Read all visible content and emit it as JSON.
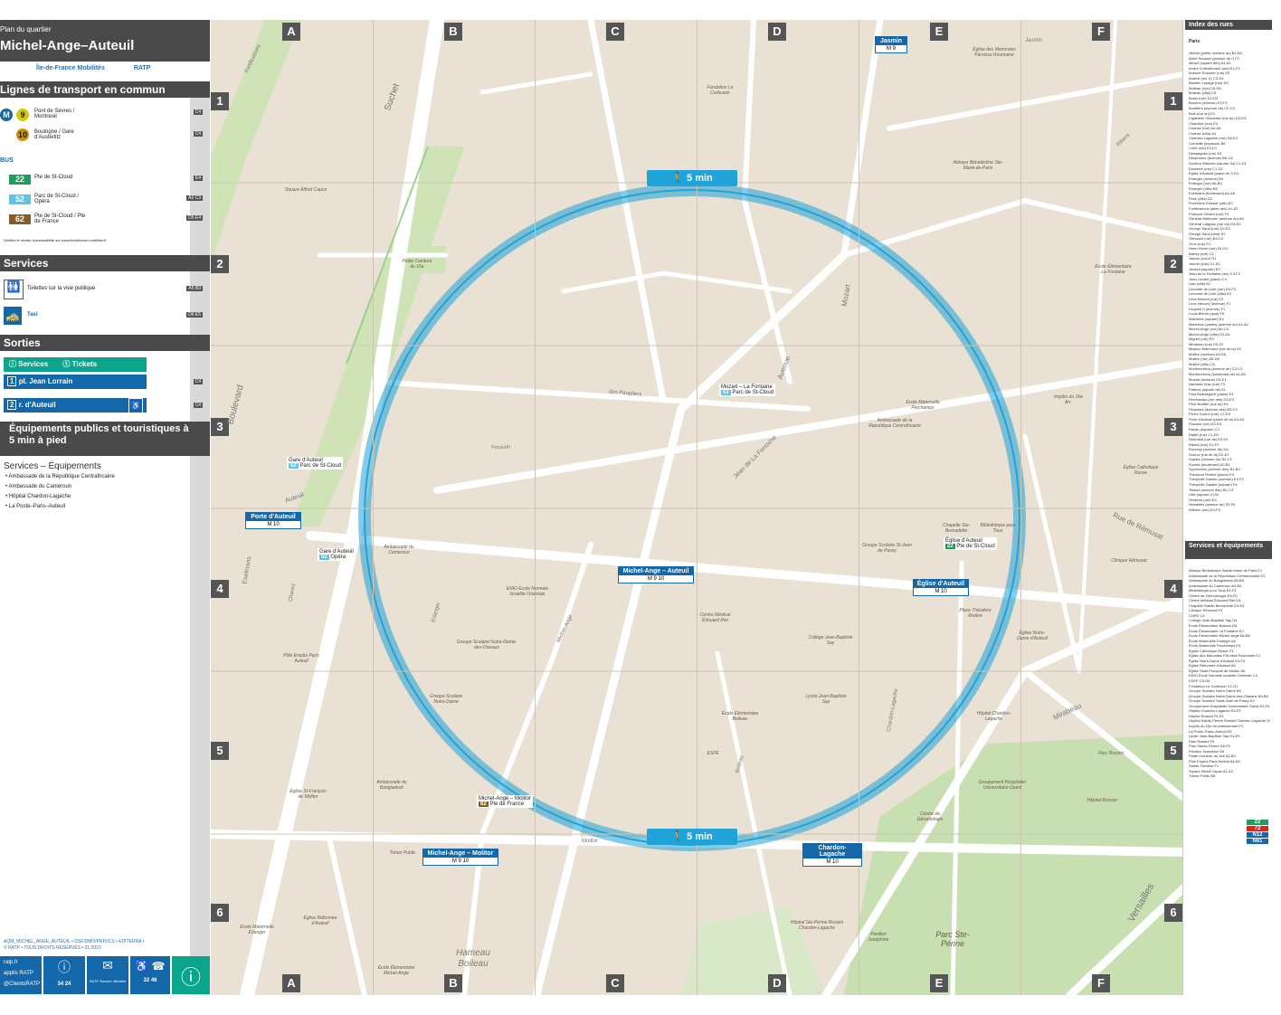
{
  "header": {
    "kicker": "Plan du quartier",
    "title": "Michel-Ange–Auteuil",
    "logo_idf": "Île-de-France Mobilités",
    "logo_ratp": "RATP"
  },
  "transport": {
    "heading": "Lignes de transport en commun",
    "metro": [
      {
        "line": "9",
        "color": "#d5c900",
        "dest": "Pont de Sèvres / Montreuil",
        "ref": "C4"
      },
      {
        "line": "10",
        "color": "#c9910d",
        "dest": "Boulogne / Gare d'Austerlitz",
        "ref": "C4"
      }
    ],
    "bus_label": "BUS",
    "bus": [
      {
        "line": "22",
        "color": "#1e9e5c",
        "dest": "Pte de St-Cloud",
        "ref": "E4"
      },
      {
        "line": "52",
        "color": "#5ec3e8",
        "dest": "Parc de St-Cloud / Opéra",
        "ref": "A3 C3"
      },
      {
        "line": "62",
        "color": "#8b5a2b",
        "dest": "Pte de St-Cloud / Pte de France",
        "ref": "D5 E4"
      }
    ],
    "note": "Vérifiez le niveau d'accessibilité sur www.iledefrance-mobilites.fr"
  },
  "services": {
    "heading": "Services",
    "items": [
      {
        "label": "Toilettes sur la voie publique",
        "ref": "A5 B3"
      },
      {
        "label": "Taxi",
        "ref": "D6 E5"
      }
    ]
  },
  "sorties": {
    "heading": "Sorties",
    "tab_services": "Services",
    "tab_tickets": "Tickets",
    "exits": [
      {
        "num": "1",
        "label": "pl. Jean Lorrain",
        "ref": "C4"
      },
      {
        "num": "2",
        "label": "r. d'Auteuil",
        "ref": "C4"
      }
    ]
  },
  "equipements": {
    "heading": "Équipements publics et touristiques à 5 min à pied",
    "sub": "Services – Équipements",
    "items": [
      "Ambassade de la République Centrafricaine",
      "Ambassade du Cameroun",
      "Hôpital Chardon-Lagache",
      "La Poste–Paris–Auteuil"
    ]
  },
  "footer": {
    "code": "AQM_MICHEL_ANGE_AUTEUIL • DSF/DMO/PRIVICS • EDITERRA •",
    "rights": "© RATP • TOUS DROITS RÉSERVÉS • 01.2023",
    "links": [
      "ratp.fr",
      "applis RATP",
      "@ClientsRATP"
    ],
    "phone1": "34 24",
    "mail": "RATP Service clientèle",
    "phone2": "32 46"
  },
  "map": {
    "columns": [
      "A",
      "B",
      "C",
      "D",
      "E",
      "F"
    ],
    "rows": [
      "1",
      "2",
      "3",
      "4",
      "5",
      "6"
    ],
    "walk_label": "5 min",
    "stations": [
      {
        "name": "Michel-Ange – Auteuil",
        "lines": "M 9 10"
      },
      {
        "name": "Porte d'Auteuil",
        "lines": "M 10"
      },
      {
        "name": "Église d'Auteuil",
        "lines": "M 10"
      },
      {
        "name": "Michel-Ange – Molitor",
        "lines": "M 9 10"
      },
      {
        "name": "Chardon-Lagache",
        "lines": "M 10"
      },
      {
        "name": "Jasmin",
        "lines": "M 9"
      }
    ],
    "bus_stops": [
      {
        "name": "Mozart – La Fontaine",
        "line": "52",
        "dest": "Parc de St-Cloud"
      },
      {
        "name": "Gare d'Auteuil",
        "line": "52",
        "dest": "Parc de St-Cloud"
      },
      {
        "name": "Gare d'Auteuil",
        "line": "52",
        "dest": "Opéra"
      },
      {
        "name": "Michel-Ange – Molitor",
        "line": "62",
        "dest": "Pte de France"
      },
      {
        "name": "Église d'Auteuil",
        "line": "22",
        "dest": "Pte de St-Cloud"
      }
    ],
    "streets": [
      "Suchet",
      "Boulevard",
      "Avenue",
      "Mozart",
      "Jean de La Fontaine",
      "Poussin",
      "Molitor",
      "Mirabeau",
      "Rue de Rémusat",
      "Versailles",
      "Exelmans",
      "Chanez",
      "Erlanger",
      "Michel-Ange",
      "Auteuil",
      "Ribera",
      "Jasmin",
      "Fortifications",
      "des Peupliers",
      "Boileau",
      "Chardon-Lagache"
    ],
    "pois": [
      "Square Alfred Capus",
      "Petite Ceinture du 16e",
      "Ambassade du Cameroun",
      "ENIO École Normale Israélite Orientale",
      "Groupe Scolaire Notre-Dame-des-Oiseaux",
      "Pôle Emploi Paris Auteuil",
      "Groupe Scolaire Notre-Dame",
      "Ambassade du Bangladesh",
      "Église St-François de Molitor",
      "Centre Médical Édouard Rist",
      "Collège Jean-Baptiste Say",
      "Lycée Jean-Baptiste Say",
      "École Élémentaire Boileau",
      "ESPE",
      "Hôpital Chardon-Lagache",
      "Groupement Hospitalier Universitaire Ouest",
      "Centre de Gérontologie",
      "Hôpital Rossini",
      "Parc Rossini",
      "Parc Ste-Périne",
      "Pavillon Joséphine",
      "Hôpital Ste-Périne Rossini Chardon-Lagache",
      "Église Notre-Dame d'Auteuil",
      "Place Théodore Rivière",
      "Église des Marionites Paroisse Roumaine",
      "Abbaye Bénédictine Ste-Marie-de-Paris",
      "Fondation Le Corbusier",
      "École Élémentaire La Fontaine",
      "École Maternelle Perchamps",
      "Ambassade de la République Centrafricaine",
      "Chapelle Ste-Bernadette",
      "Bibliothèque pour Tous",
      "Groupe Scolaire St-Jean de Passy",
      "Clinique Rémusat",
      "Église Catholique Russe",
      "Impôts du 16e Arr.",
      "Trésor Public",
      "Église Réformée d'Auteuil",
      "École Maternelle Erlanger",
      "École Élémentaire Michel-Ange",
      "Hameau Boileau"
    ]
  },
  "index": {
    "heading": "Index des rues",
    "city": "Paris",
    "streets": [
      "18ème (petite ceinture du) B1-B2",
      "Abbé Roussel (avenue de l') F2",
      "Alboni (square des) A1-A1",
      "André Colledeboeuf (rue) E1-F1",
      "Antoine Roucher (rue) E5",
      "Auteuil (rue d') C3-D4",
      "Bastien Lepage (rue) D3",
      "Boileau (rue) C6-D6",
      "Boileau (villa) C5",
      "Bosio (rue) D2-D3",
      "Boudon (avenue) E3-F2",
      "Boufflers (avenue de) C2-C3",
      "Bois (rue du) E4",
      "Capitaine Olchanski (rue du) D2-D3",
      "Chamfort (rue) E4",
      "Chanez (rue) A4-A5",
      "Chanez (villa) A4",
      "Chardon-Lagache (rue) D6-E4",
      "Corneille (impasse) B6",
      "Conti (rue) E4-F4",
      "Dessaignes (rue) E4",
      "Despreaux (avenue) B6-C6",
      "Docteur Blanche (square du) C1-D1",
      "Donizetti (rue) C1-D2",
      "Église d'Auteuil (place de l') E4",
      "Erlanger (avenue) B4",
      "Erlanger (rue) A6-B4",
      "Erlanger (villa) B5",
      "Exelmans (boulevard) A4-A6",
      "Flore (villa) D2",
      "Florentine Estrade (cité) E2",
      "Fortifications (allée des) A1-A2",
      "François Gérard (rue) F3",
      "Général Balfourier (avenue du) A6",
      "Général Largeau (rue du) D3-E3",
      "George Sand (rue) D2-E3",
      "George Sand (villa) E2",
      "Géricault (rue) B3-C3",
      "Gros (rue) E1",
      "Henri Heine (rue) D1-D2",
      "Isabey (rue) C2",
      "Jasmin (cour) D1",
      "Jasmin (rue) D1-E1",
      "Javelot (square) E2",
      "Jean de la Fontaine (rue) C3-F2",
      "Jean Lorrain (place) C4",
      "Lalo (villa) B1",
      "Lecomte de Lisle (rue) D3-F3",
      "Lecomte de Lisle (villa) E3",
      "Léon Bonnat (rue) E2",
      "Léon Heuzey (avenue) F1",
      "Léopold II (avenue) F1",
      "Louis Blériot (quai) F6",
      "Malherbe (square) E4",
      "Maréchal Lyautey (avenue du) A1-A2",
      "Michel-Ange (rue) A6-C4",
      "Michel-Ange (villa) D3-D4",
      "Mignet (rue) E3",
      "Mirabeau (rue) E5-F4",
      "Mission Marchand (rue de la) D2",
      "Molitor (avenue) A5-D6",
      "Molitor (rue) A5-D6",
      "Molitor (villa) C6",
      "Montmorency (avenue de) C2-C3",
      "Montmorency (boulevard de) A1-B1",
      "Mozart (avenue) D3-E1",
      "Narcisse Diaz (rue) F3",
      "Padirac (square de) A1",
      "Paul Beauregard (place) E3",
      "Perchamps (rue des) D3-E3",
      "Père Brottier (rue du) E4",
      "Peupliers (avenue des) B3-C3",
      "Pierre Guérin (rue) C2-D4",
      "Porte d'Auteuil (place de la) A3-A3",
      "Poussin (rue) A3-D3",
      "Racan (square) C2",
      "Raffet (rue) C1-D2",
      "Rémusat (rue de) E3-F4",
      "Ribera (rue) E1-F2",
      "Rouvray (avenue de) D4",
      "Source (rue de la) D2-E1",
      "Square (avenue du) B2-C2",
      "Suchet (boulevard) A2-B1",
      "Sycomores (avenue des) B1-B3",
      "Théodore Rivière (place) E4",
      "Théophile Gautier (avenue) E4-F2",
      "Théophile Gautier (square) F4",
      "Tilleuls (avenue des) B1-C2",
      "Urfé (square d') A2",
      "Verderet (rue) E4",
      "Versailles (avenue de) F5-F6",
      "Wilhem (rue) E4-F5"
    ],
    "services_heading": "Services et équipements",
    "services": [
      "Abbaye Bénédictine Sainte-Marie de Paris E1",
      "Ambassade de la République Centrafricaine E3",
      "Ambassade du Bangladesh A5-B5",
      "Ambassade du Cameroun A4-B4",
      "Bibliothèque pour Tous E4-F4",
      "Centre de Gérontologie E5-F5",
      "Centre Médical Édouard Rist D4",
      "Chapelle Sainte-Bernadette E3-E4",
      "Clinique Rémusat F4",
      "CNRS C4",
      "Collège Jean-Baptiste Say D4",
      "École Élémentaire Boileau D5",
      "École Élémentaire La Fontaine E2",
      "École Élémentaire Michel-Ange A6-B6",
      "École Maternelle Erlanger A6",
      "École Maternelle Perchamps E3",
      "Église Catholique Russe F3",
      "Église des Maronites Paroisse Roumaine E1",
      "Église Notre-Dame d'Auteuil E4-F4",
      "Église Réformée d'Auteuil A6",
      "Église Saint-François de Molitor A5",
      "ENIO École Normale Israélite Orientale C4",
      "ESPE C5-D5",
      "Fondation Le Corbusier C1-D1",
      "Groupe Scolaire Notre-Dame B5",
      "Groupe Scolaire Notre-Dame-des-Oiseaux B4-B5",
      "Groupe Scolaire Saint-Jean de Passy E4",
      "Groupement Hospitalier Universitaire Ouest E5-F5",
      "Hôpital Chardon-Lagache E5-F5",
      "Hôpital Rossini F5-F6",
      "Hôpital Sainte-Périne Rossini Chardon-Lagache D6-E6",
      "Impôts du 16e Arrondissement F3",
      "La Poste–Paris–Auteuil B3",
      "Lycée Jean-Baptiste Say D4-E5",
      "Parc Rossini F5",
      "Parc Sainte-Périne D6-F5",
      "Pavillon Joséphine E6",
      "Petite Ceinture du 16e A2-B2",
      "Pôle Emploi Paris Auteuil A4-A5",
      "Sainte-Thérèse F1",
      "Square Alfred Capus A1-A2",
      "Trésor Public B6"
    ],
    "bus_badges": [
      "22",
      "72",
      "N12",
      "N61"
    ]
  }
}
